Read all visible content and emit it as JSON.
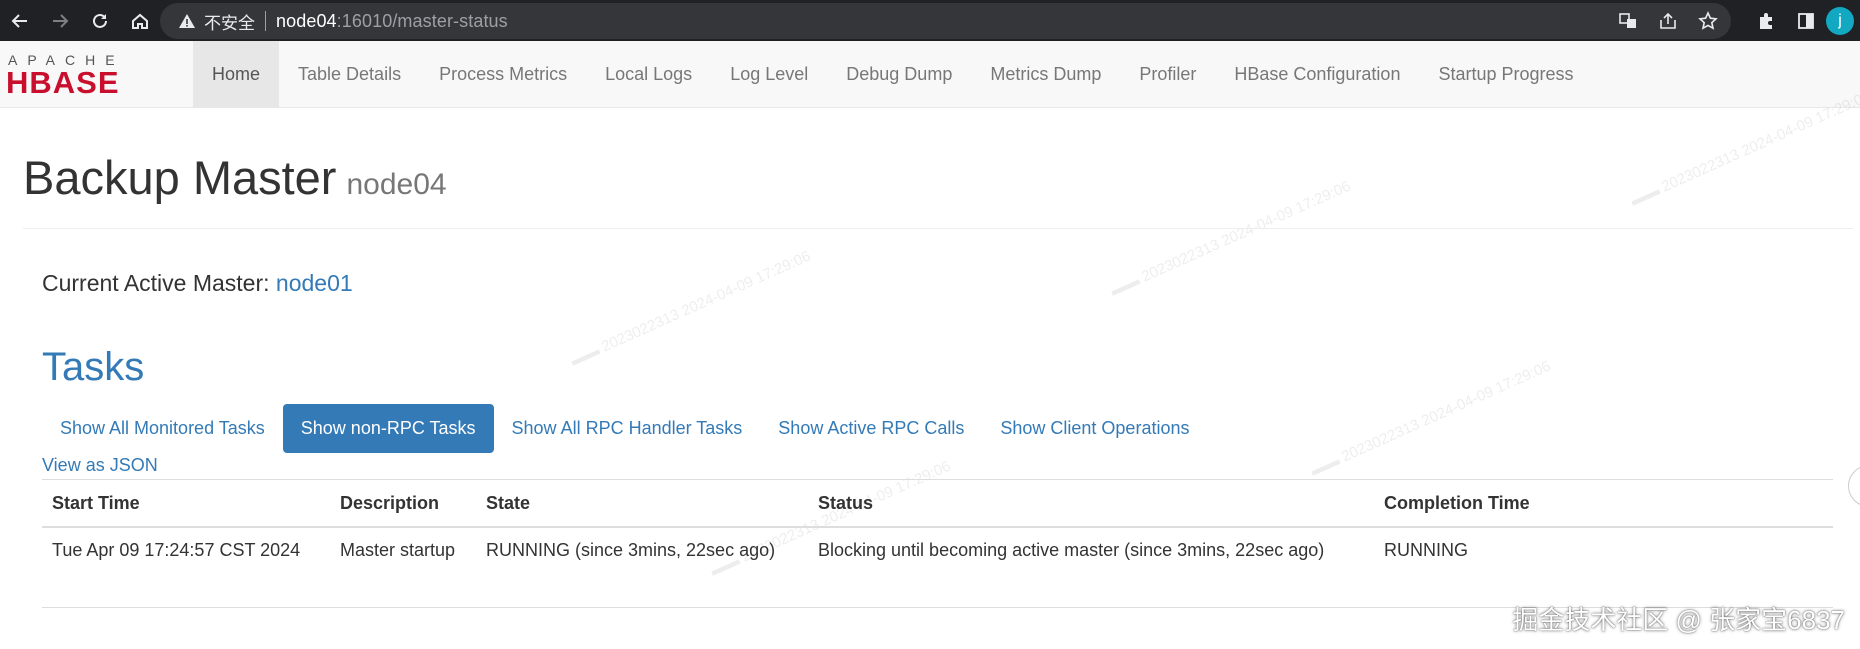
{
  "browser": {
    "insecure_label": "不安全",
    "url_host": "node04",
    "url_rest": ":16010/master-status",
    "avatar_letter": "j"
  },
  "navbar": {
    "logo_alt": "APACHE HBASE",
    "logo_top": "APACHE",
    "logo_main": "HBASE",
    "items": [
      {
        "label": "Home",
        "active": true
      },
      {
        "label": "Table Details"
      },
      {
        "label": "Process Metrics"
      },
      {
        "label": "Local Logs"
      },
      {
        "label": "Log Level"
      },
      {
        "label": "Debug Dump"
      },
      {
        "label": "Metrics Dump"
      },
      {
        "label": "Profiler"
      },
      {
        "label": "HBase Configuration"
      },
      {
        "label": "Startup Progress"
      }
    ]
  },
  "header": {
    "title": "Backup Master",
    "subtitle": "node04"
  },
  "active_master": {
    "label": "Current Active Master: ",
    "node": "node01"
  },
  "tasks": {
    "title": "Tasks",
    "pills": [
      {
        "label": "Show All Monitored Tasks"
      },
      {
        "label": "Show non-RPC Tasks",
        "active": true
      },
      {
        "label": "Show All RPC Handler Tasks"
      },
      {
        "label": "Show Active RPC Calls"
      },
      {
        "label": "Show Client Operations"
      }
    ],
    "view_json": "View as JSON",
    "columns": [
      "Start Time",
      "Description",
      "State",
      "Status",
      "Completion Time"
    ],
    "rows": [
      [
        "Tue Apr 09 17:24:57 CST 2024",
        "Master startup",
        "RUNNING (since 3mins, 22sec ago)",
        "Blocking until becoming active master (since 3mins, 22sec ago)",
        "RUNNING"
      ]
    ]
  },
  "watermark": "掘金技术社区 @ 张家宝6837",
  "colors": {
    "link": "#337ab7",
    "active_pill": "#337ab7",
    "logo_red": "#c8102e",
    "chrome_bg": "#202124"
  }
}
